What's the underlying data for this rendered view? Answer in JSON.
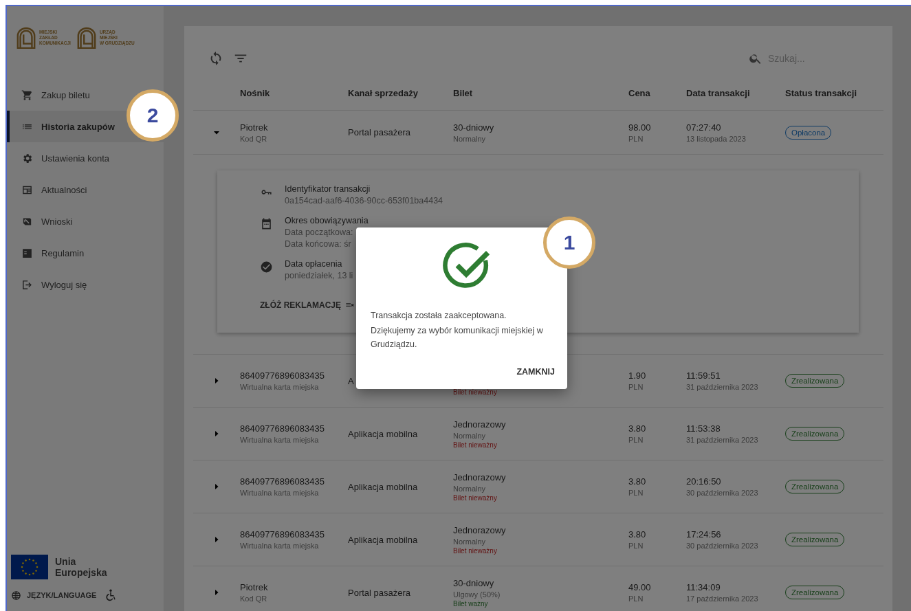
{
  "sidebar": {
    "logos": [
      {
        "lines": [
          "MIEJSKI",
          "ZAKŁAD",
          "KOMUNIKACJI"
        ]
      },
      {
        "lines": [
          "URZĄD",
          "MIEJSKI",
          "W GRUDZIĄDZU"
        ]
      }
    ],
    "items": [
      {
        "label": "Zakup biletu",
        "selected": false
      },
      {
        "label": "Historia zakupów",
        "selected": true
      },
      {
        "label": "Ustawienia konta",
        "selected": false
      },
      {
        "label": "Aktualności",
        "selected": false
      },
      {
        "label": "Wnioski",
        "selected": false
      },
      {
        "label": "Regulamin",
        "selected": false
      },
      {
        "label": "Wyloguj się",
        "selected": false
      }
    ],
    "eu_label": [
      "Unia",
      "Europejska"
    ],
    "language": "JĘZYK/LANGUAGE"
  },
  "search": {
    "placeholder": "Szukaj..."
  },
  "table": {
    "columns": [
      "Nośnik",
      "Kanał sprzedaży",
      "Bilet",
      "Cena",
      "Data transakcji",
      "Status transakcji"
    ],
    "rows": [
      {
        "expanded": true,
        "carrier": "Piotrek",
        "carrier_type": "Kod QR",
        "channel": "Portal pasażera",
        "ticket": "30-dniowy",
        "ticket_type": "Normalny",
        "price": "98.00",
        "currency": "PLN",
        "time": "07:27:40",
        "date": "13 listopada 2023",
        "status": "Opłacona",
        "paid": true
      },
      {
        "expanded": false,
        "carrier": "86409776896083435",
        "carrier_type": "Wirtualna karta miejska",
        "channel": "A",
        "validity": "Bilet nieważny",
        "valid": false,
        "price": "1.90",
        "currency": "PLN",
        "time": "11:59:51",
        "date": "31 października 2023",
        "status": "Zrealizowana",
        "paid": false
      },
      {
        "expanded": false,
        "carrier": "86409776896083435",
        "carrier_type": "Wirtualna karta miejska",
        "channel": "Aplikacja mobilna",
        "ticket": "Jednorazowy",
        "ticket_type": "Normalny",
        "validity": "Bilet nieważny",
        "valid": false,
        "price": "3.80",
        "currency": "PLN",
        "time": "11:53:38",
        "date": "31 października 2023",
        "status": "Zrealizowana",
        "paid": false
      },
      {
        "expanded": false,
        "carrier": "86409776896083435",
        "carrier_type": "Wirtualna karta miejska",
        "channel": "Aplikacja mobilna",
        "ticket": "Jednorazowy",
        "ticket_type": "Normalny",
        "validity": "Bilet nieważny",
        "valid": false,
        "price": "3.80",
        "currency": "PLN",
        "time": "20:16:50",
        "date": "30 października 2023",
        "status": "Zrealizowana",
        "paid": false
      },
      {
        "expanded": false,
        "carrier": "86409776896083435",
        "carrier_type": "Wirtualna karta miejska",
        "channel": "Aplikacja mobilna",
        "ticket": "Jednorazowy",
        "ticket_type": "Normalny",
        "validity": "Bilet nieważny",
        "valid": false,
        "price": "3.80",
        "currency": "PLN",
        "time": "17:24:56",
        "date": "30 października 2023",
        "status": "Zrealizowana",
        "paid": false
      },
      {
        "expanded": false,
        "carrier": "Piotrek",
        "carrier_type": "Kod QR",
        "channel": "Portal pasażera",
        "ticket": "30-dniowy",
        "ticket_type": "Ulgowy (50%)",
        "validity": "Bilet ważny",
        "valid": true,
        "price": "49.00",
        "currency": "PLN",
        "time": "11:34:09",
        "date": "17 października 2023",
        "status": "Zrealizowana",
        "paid": false
      }
    ]
  },
  "details": {
    "items": [
      {
        "title": "Identyfikator transakcji",
        "lines": [
          "0a154cad-aaf6-4036-90cc-653f01ba4434"
        ]
      },
      {
        "title": "Okres obowiązywania",
        "lines": [
          "Data początkowa:",
          "Data końcowa: śr"
        ]
      },
      {
        "title": "Data opłacenia",
        "lines": [
          "poniedziałek, 13 li"
        ]
      }
    ],
    "action": "ZŁÓŻ REKLAMACJĘ"
  },
  "dialog": {
    "lines": [
      "Transakcja została zaakceptowana.",
      "Dziękujemy za wybór komunikacji miejskiej w Grudziądzu."
    ],
    "button": "ZAMKNIJ"
  },
  "callouts": [
    {
      "number": "1"
    },
    {
      "number": "2"
    }
  ]
}
